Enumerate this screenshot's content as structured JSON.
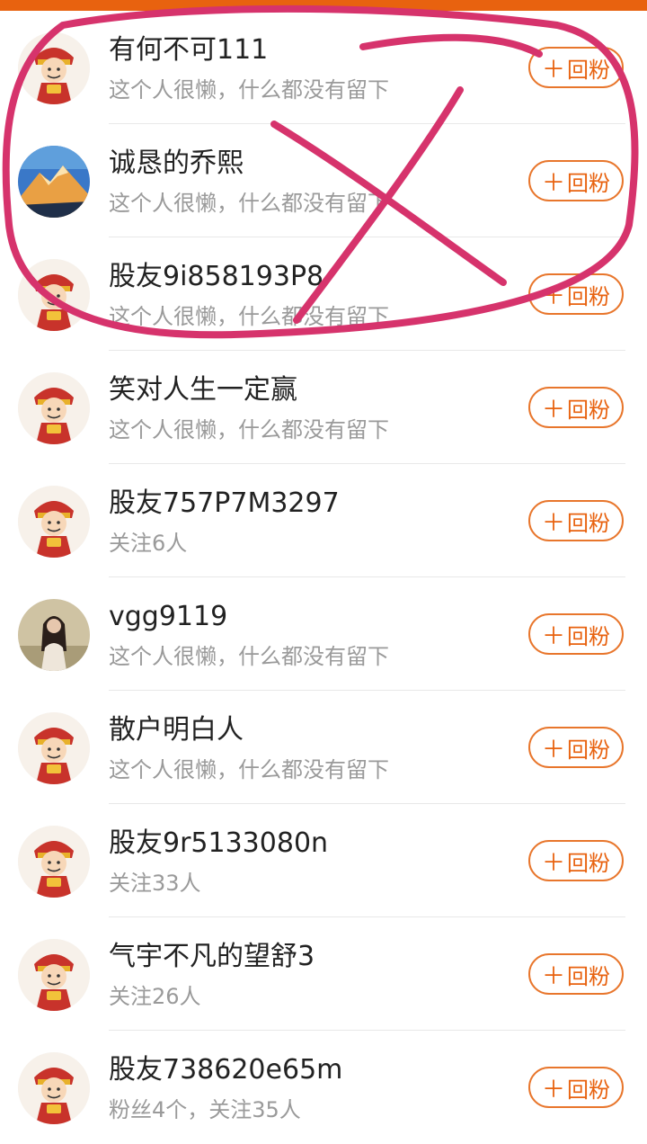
{
  "follow_back_label": "回粉",
  "plus_symbol": "＋",
  "rows": [
    {
      "name": "有何不可111",
      "sub": "这个人很懒，什么都没有留下",
      "avatar": "fortune-god-avatar"
    },
    {
      "name": "诚恳的乔熙",
      "sub": "这个人很懒，什么都没有留下",
      "avatar": "mountain-photo-avatar"
    },
    {
      "name": "股友9i858193P8",
      "sub": "这个人很懒，什么都没有留下",
      "avatar": "fortune-god-avatar"
    },
    {
      "name": "笑对人生一定赢",
      "sub": "这个人很懒，什么都没有留下",
      "avatar": "fortune-god-avatar"
    },
    {
      "name": "股友757P7M3297",
      "sub": "关注6人",
      "avatar": "fortune-god-avatar"
    },
    {
      "name": "vgg9119",
      "sub": "这个人很懒，什么都没有留下",
      "avatar": "woman-photo-avatar"
    },
    {
      "name": "散户明白人",
      "sub": "这个人很懒，什么都没有留下",
      "avatar": "fortune-god-avatar"
    },
    {
      "name": "股友9r5133080n",
      "sub": "关注33人",
      "avatar": "fortune-god-avatar"
    },
    {
      "name": "气宇不凡的望舒3",
      "sub": "关注26人",
      "avatar": "fortune-god-avatar"
    },
    {
      "name": "股友738620e65m",
      "sub": "粉丝4个，关注35人",
      "avatar": "fortune-god-avatar"
    }
  ],
  "colors": {
    "accent": "#e8620f",
    "annotation": "#d6336c"
  }
}
